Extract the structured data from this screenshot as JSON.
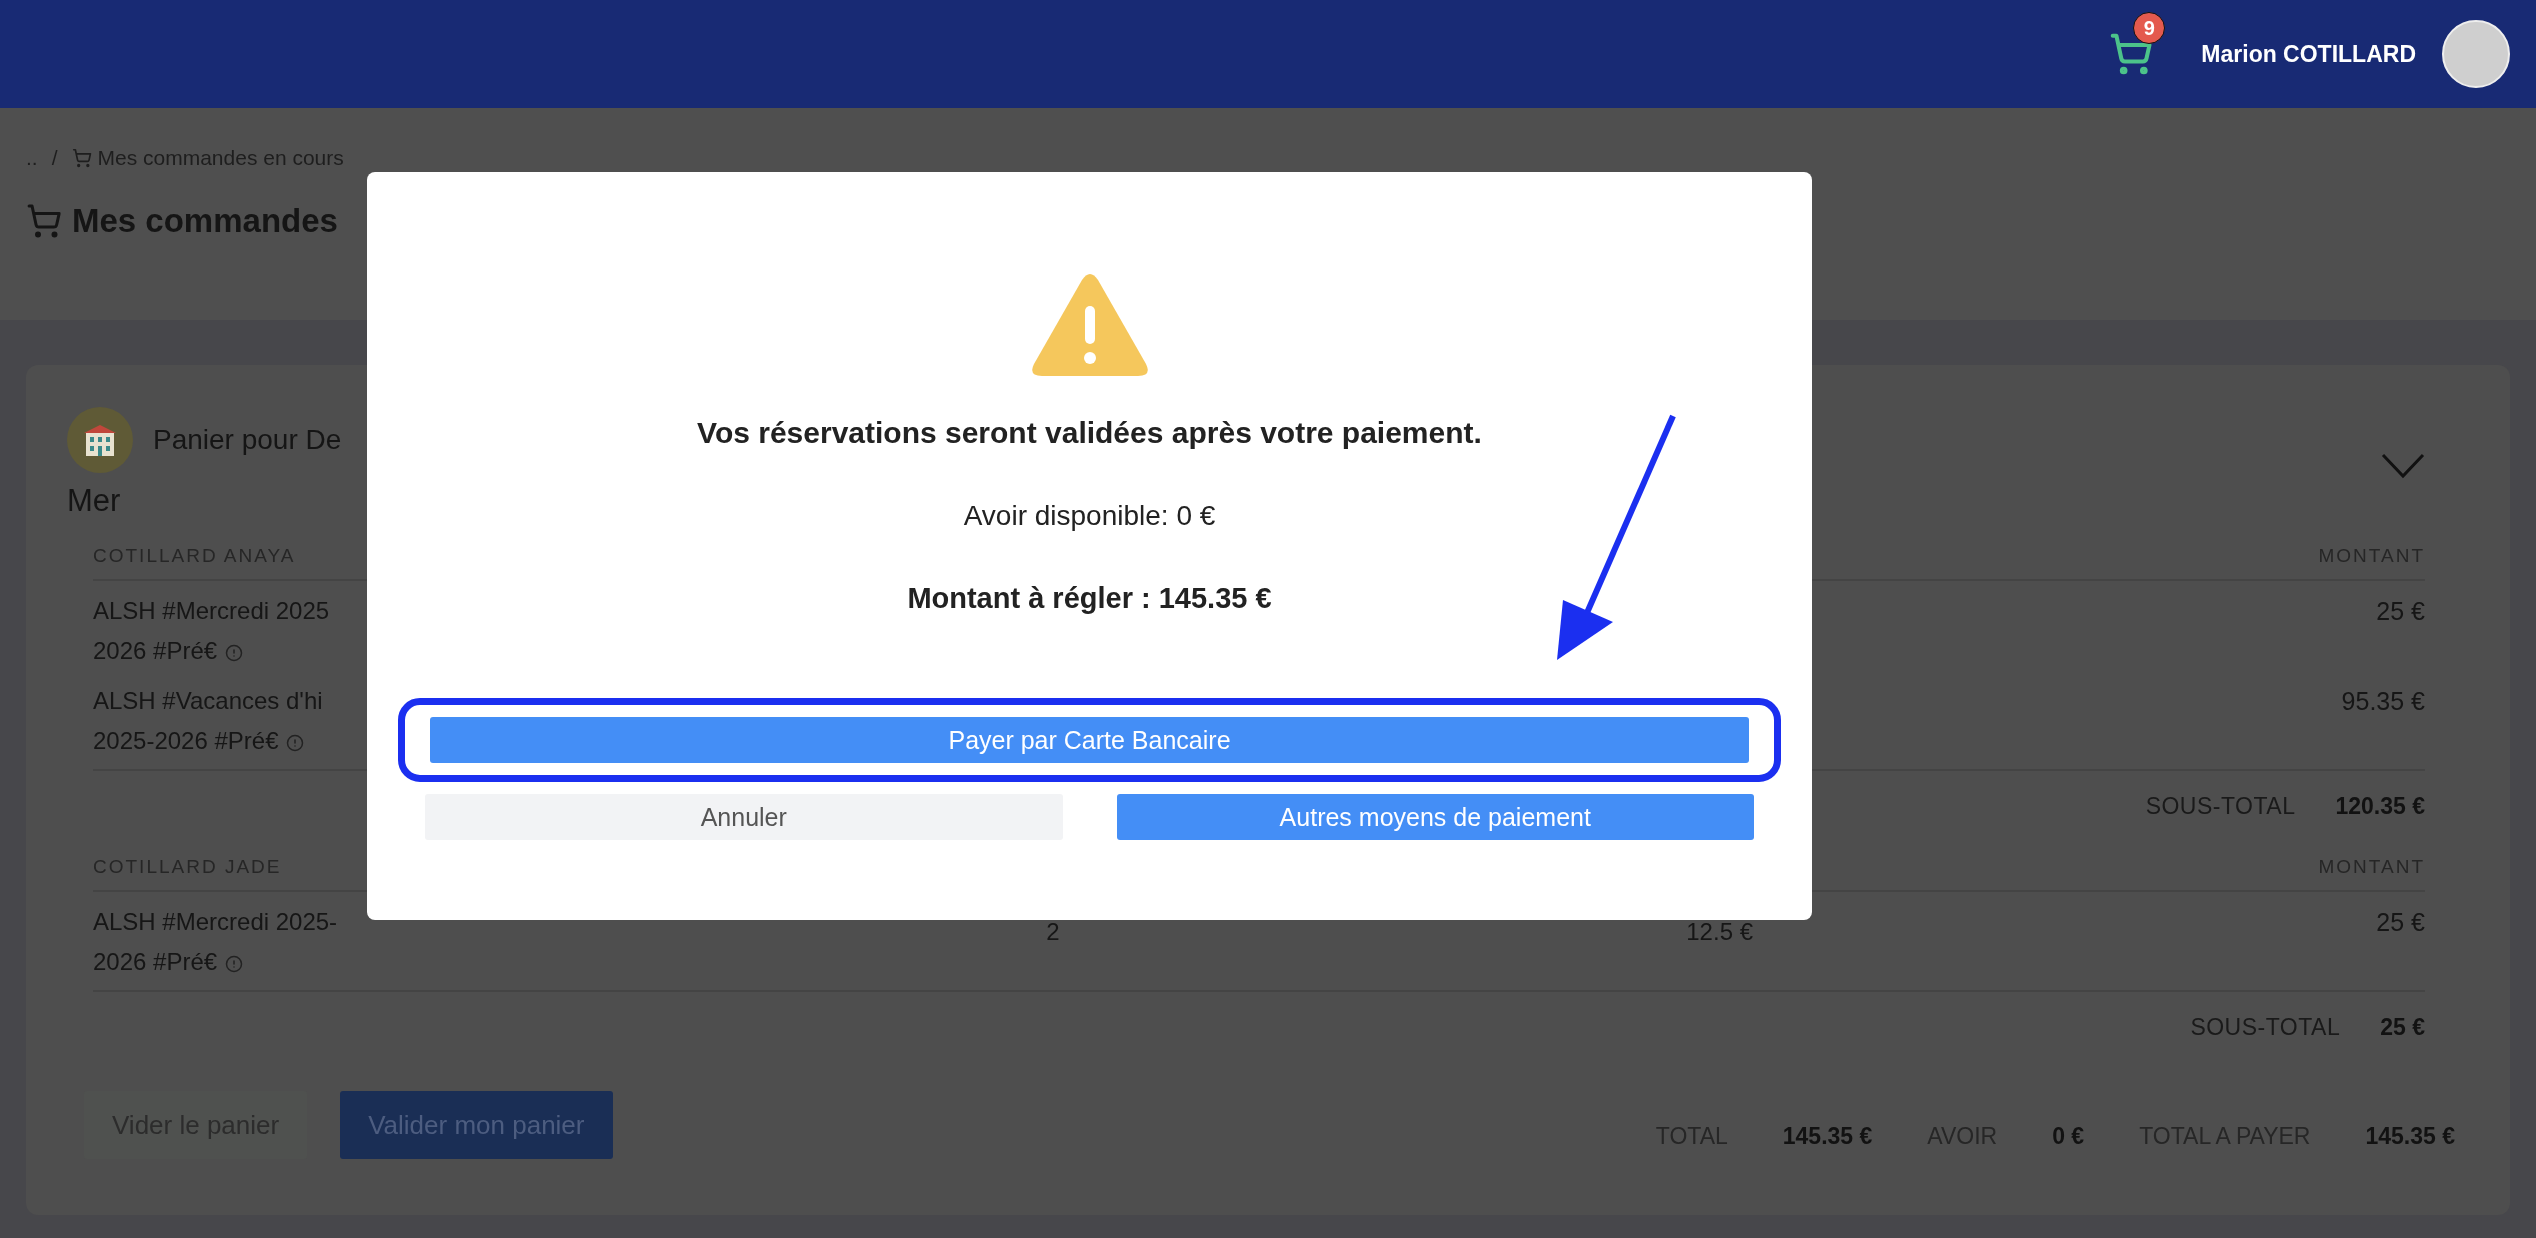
{
  "header": {
    "cart_badge": "9",
    "user_name": "Marion COTILLARD"
  },
  "breadcrumb": {
    "parent": "..",
    "separator": "/",
    "current": "Mes commandes en cours"
  },
  "page_title": "Mes commandes",
  "cart": {
    "title": "Panier pour De",
    "subtitle": "Mer",
    "groups": [
      {
        "name": "COTILLARD ANAYA",
        "amount_header": "MONTANT",
        "subtotal_label": "SOUS-TOTAL",
        "subtotal": "120.35 €",
        "items": [
          {
            "description": "ALSH #Mercredi 2025\n2026 #Pré€",
            "amount": "25 €"
          },
          {
            "description": "ALSH #Vacances d'hi\n2025-2026 #Pré€",
            "amount": "95.35 €"
          }
        ]
      },
      {
        "name": "COTILLARD JADE",
        "amount_header": "MONTANT",
        "subtotal_label": "SOUS-TOTAL",
        "subtotal": "25 €",
        "items": [
          {
            "description": "ALSH #Mercredi 2025-\n2026 #Pré€",
            "quantity": "2",
            "unit_price": "12.5 €",
            "amount": "25 €"
          }
        ]
      }
    ],
    "actions": [
      {
        "label": "Vider le panier",
        "kind": "secondary"
      },
      {
        "label": "Valider mon panier",
        "kind": "primary"
      }
    ],
    "totals": [
      {
        "label": "TOTAL",
        "value": "145.35 €"
      },
      {
        "label": "AVOIR",
        "value": "0 €"
      },
      {
        "label": "TOTAL A PAYER",
        "value": "145.35 €"
      }
    ]
  },
  "modal": {
    "heading": "Vos réservations seront validées après votre paiement.",
    "credit": "Avoir disponible: 0 €",
    "amount_due": "Montant à régler : 145.35 €",
    "main_button": {
      "label": "Payer par Carte Bancaire",
      "highlighted": true
    },
    "buttons": [
      {
        "label": "Annuler",
        "kind": "secondary"
      },
      {
        "label": "Autres moyens de paiement",
        "kind": "primary"
      }
    ]
  }
}
